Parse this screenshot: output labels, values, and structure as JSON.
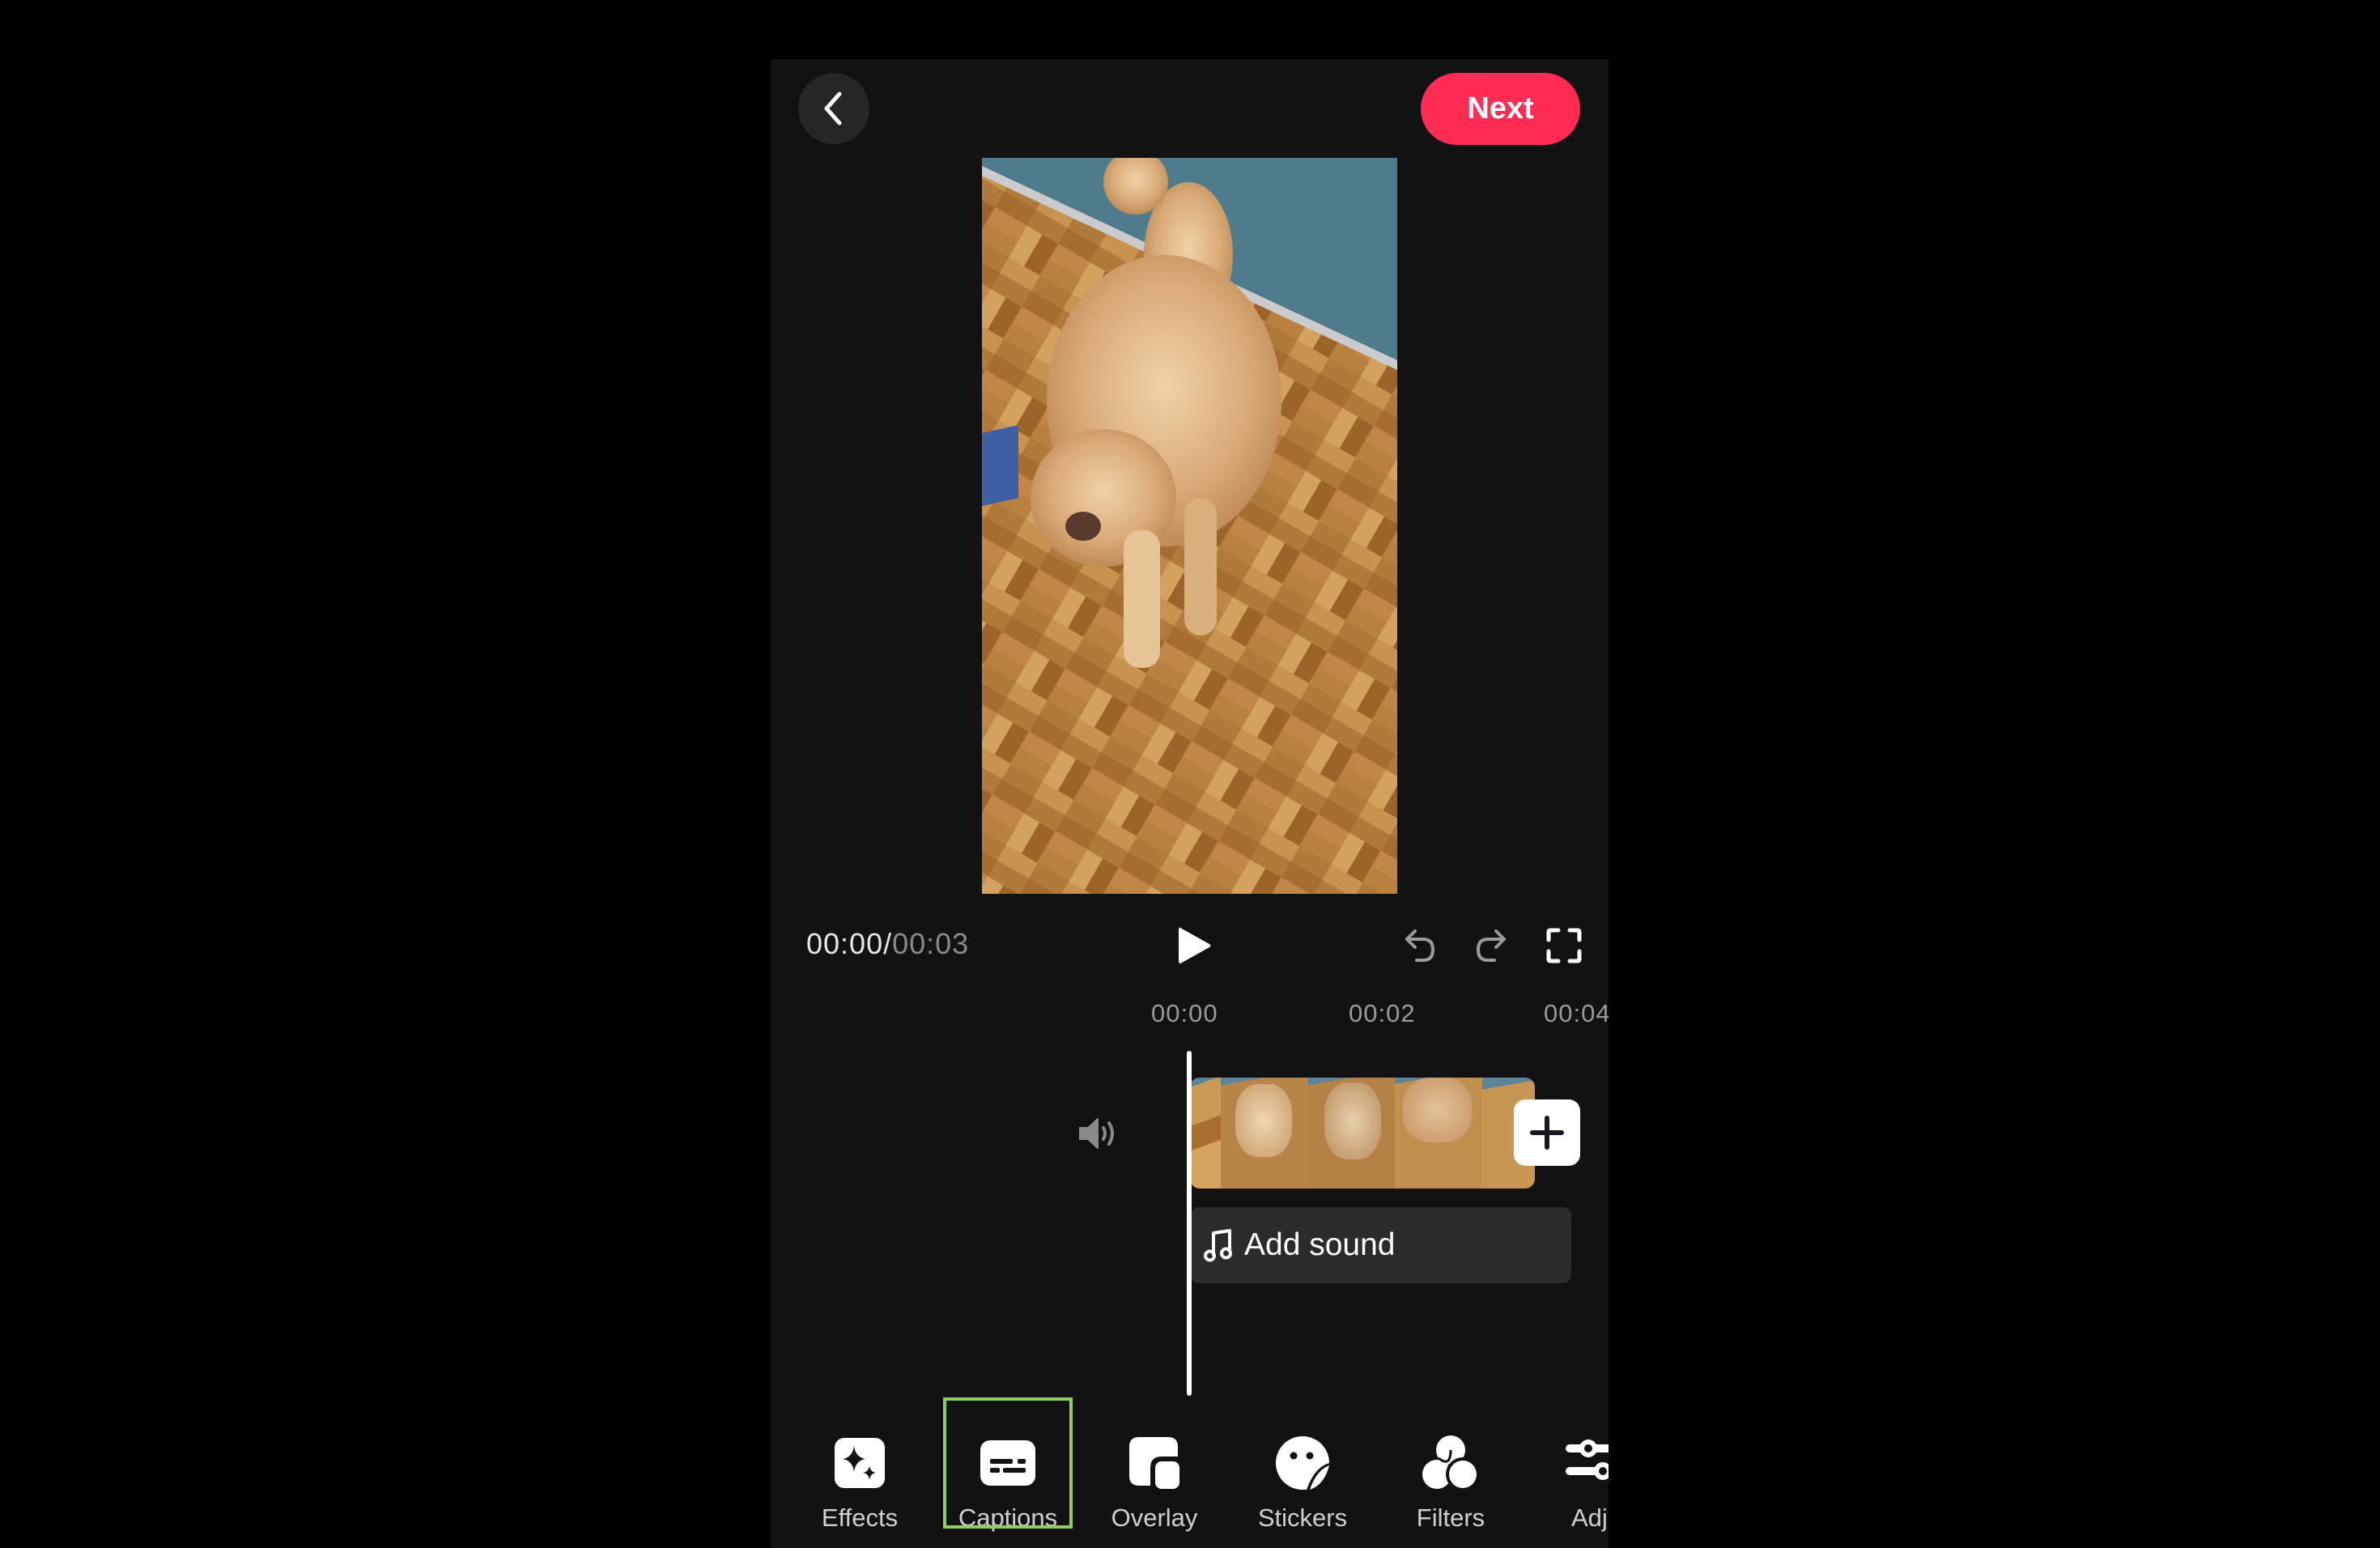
{
  "header": {
    "back_icon": "chevron-left-icon",
    "next_label": "Next",
    "accent_color": "#fe2c55"
  },
  "preview": {
    "description": "video preview: curly apricot dog walking on herringbone parquet floor"
  },
  "playback": {
    "current_time": "00:00",
    "separator": "/",
    "total_time": "00:03",
    "play_icon": "play-icon",
    "undo_icon": "undo-icon",
    "redo_icon": "redo-icon",
    "fullscreen_icon": "fullscreen-icon"
  },
  "timeline": {
    "ruler": [
      "00:00",
      "00:02",
      "00:04"
    ],
    "volume_icon": "speaker-icon",
    "clip_frames": 5,
    "add_clip_icon": "plus-icon",
    "add_sound_label": "Add sound",
    "add_sound_icon": "music-note-icon"
  },
  "toolbar": {
    "items": [
      {
        "label": "Effects",
        "icon": "sparkle-icon"
      },
      {
        "label": "Captions",
        "icon": "captions-icon",
        "highlighted": true
      },
      {
        "label": "Overlay",
        "icon": "overlay-icon"
      },
      {
        "label": "Stickers",
        "icon": "sticker-icon"
      },
      {
        "label": "Filters",
        "icon": "filters-icon"
      },
      {
        "label": "Adju",
        "icon": "adjust-icon"
      }
    ],
    "highlight_color": "#8fce5e"
  }
}
